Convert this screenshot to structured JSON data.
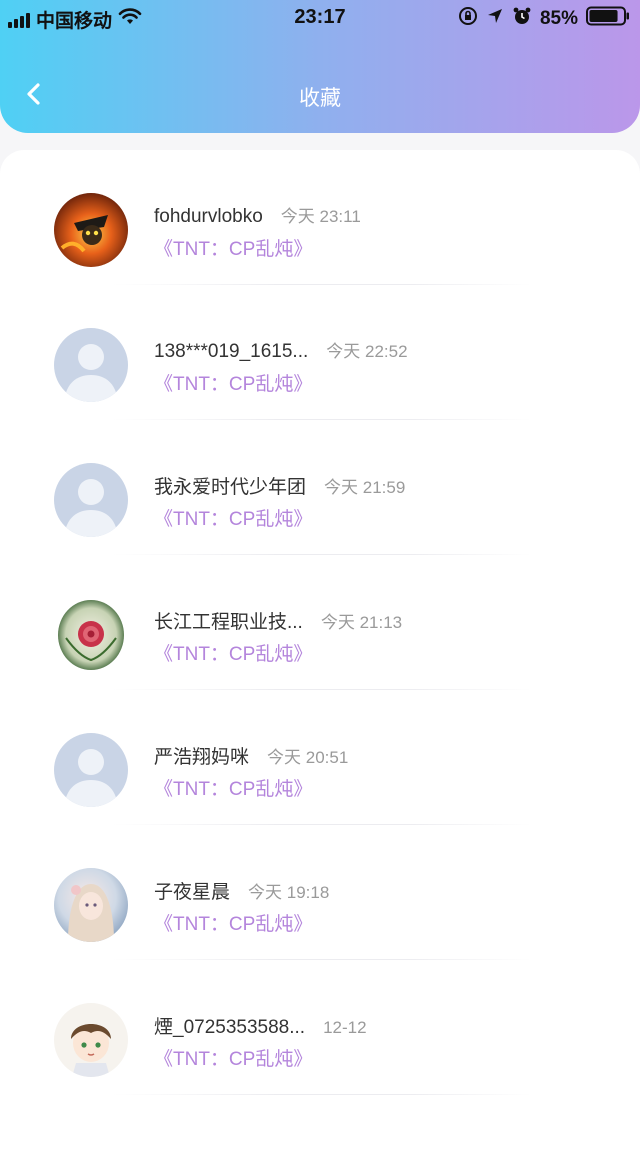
{
  "status_bar": {
    "carrier": "中国移动",
    "time": "23:17",
    "battery_percent": "85%",
    "battery_level": 0.85,
    "icons": [
      "signal-icon",
      "wifi-icon",
      "orientation-lock-icon",
      "location-icon",
      "alarm-icon",
      "battery-icon"
    ]
  },
  "header": {
    "title": "收藏",
    "back_icon": "back-chevron-icon",
    "gradient": [
      "#4fd0f4",
      "#8fb0ee",
      "#bb97ea"
    ]
  },
  "colors": {
    "accent": "#b485dc",
    "name_text": "#333333",
    "time_text": "#9a9a9a"
  },
  "favorites": [
    {
      "name": "fohdurvlobko",
      "time": "今天 23:11",
      "book": "《TNT：CP乱炖》",
      "avatar": "custom-game-avatar"
    },
    {
      "name": "138***019_1615...",
      "time": "今天 22:52",
      "book": "《TNT：CP乱炖》",
      "avatar": "default-avatar"
    },
    {
      "name": "我永爱时代少年团",
      "time": "今天 21:59",
      "book": "《TNT：CP乱炖》",
      "avatar": "default-avatar"
    },
    {
      "name": "长江工程职业技...",
      "time": "今天 21:13",
      "book": "《TNT：CP乱炖》",
      "avatar": "carved-rose-avatar"
    },
    {
      "name": "严浩翔妈咪",
      "time": "今天 20:51",
      "book": "《TNT：CP乱炖》",
      "avatar": "default-avatar"
    },
    {
      "name": "子夜星晨",
      "time": "今天 19:18",
      "book": "《TNT：CP乱炖》",
      "avatar": "anime-girl-avatar"
    },
    {
      "name": "煙_0725353588...",
      "time": "12-12",
      "book": "《TNT：CP乱炖》",
      "avatar": "chibi-boy-avatar"
    }
  ]
}
